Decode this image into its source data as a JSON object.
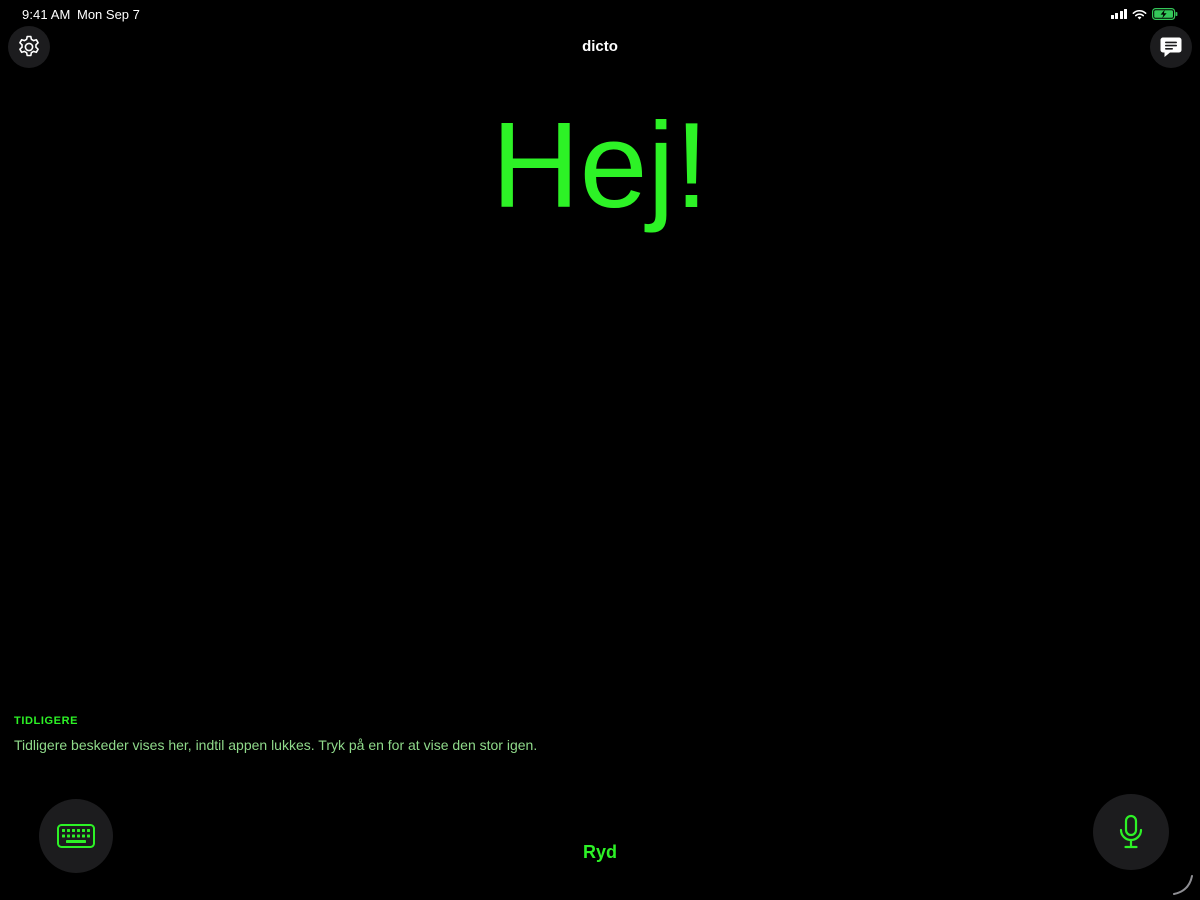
{
  "status_bar": {
    "time": "9:41 AM",
    "date": "Mon Sep 7",
    "icons": [
      "cellular-signal-icon",
      "wifi-icon",
      "battery-charging-icon"
    ]
  },
  "nav": {
    "title": "dicto",
    "left_icon": "gear-icon",
    "right_icon": "speech-bubble-icon"
  },
  "main": {
    "message": "Hej!"
  },
  "history": {
    "heading": "TIDLIGERE",
    "hint": "Tidligere beskeder vises her, indtil appen lukkes. Tryk på en for at vise den stor igen."
  },
  "controls": {
    "keyboard_icon": "keyboard-icon",
    "microphone_icon": "microphone-icon",
    "clear_label": "Ryd"
  },
  "colors": {
    "accent": "#2df226",
    "accent_muted": "#8fd98a",
    "background": "#000000",
    "button_bg": "#1c1c1e",
    "battery": "#34c759"
  }
}
